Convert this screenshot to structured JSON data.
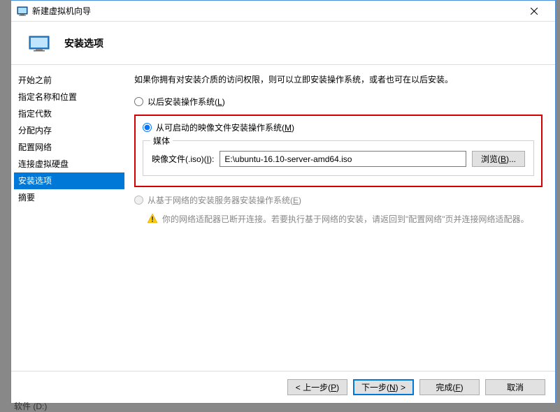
{
  "titlebar": {
    "title": "新建虚拟机向导"
  },
  "header": {
    "title": "安装选项"
  },
  "sidebar": {
    "items": [
      {
        "label": "开始之前"
      },
      {
        "label": "指定名称和位置"
      },
      {
        "label": "指定代数"
      },
      {
        "label": "分配内存"
      },
      {
        "label": "配置网络"
      },
      {
        "label": "连接虚拟硬盘"
      },
      {
        "label": "安装选项",
        "selected": true
      },
      {
        "label": "摘要"
      }
    ]
  },
  "content": {
    "intro": "如果你拥有对安装介质的访问权限，则可以立即安装操作系统，或者也可在以后安装。",
    "option_later_prefix": "以后安装操作系统(",
    "option_later_key": "L",
    "option_later_suffix": ")",
    "option_boot_prefix": "从可启动的映像文件安装操作系统(",
    "option_boot_key": "M",
    "option_boot_suffix": ")",
    "media": {
      "legend": "媒体",
      "label_prefix": "映像文件(.iso)(",
      "label_key": "I",
      "label_suffix": "):",
      "value": "E:\\ubuntu-16.10-server-amd64.iso",
      "browse_prefix": "浏览(",
      "browse_key": "B",
      "browse_suffix": ")..."
    },
    "option_network_prefix": "从基于网络的安装服务器安装操作系统(",
    "option_network_key": "E",
    "option_network_suffix": ")",
    "warning": "你的网络适配器已断开连接。若要执行基于网络的安装，请返回到\"配置网络\"页并连接网络适配器。"
  },
  "footer": {
    "prev_prefix": "< 上一步(",
    "prev_key": "P",
    "prev_suffix": ")",
    "next_prefix": "下一步(",
    "next_key": "N",
    "next_suffix": ") >",
    "finish_prefix": "完成(",
    "finish_key": "F",
    "finish_suffix": ")",
    "cancel": "取消"
  },
  "artifact": {
    "below": "软件 (D:)"
  }
}
